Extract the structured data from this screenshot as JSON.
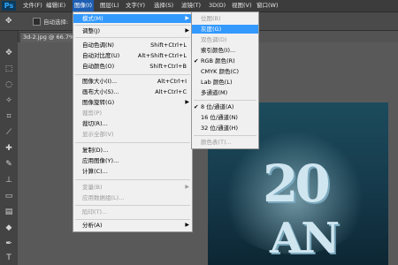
{
  "app": {
    "logo": "Ps"
  },
  "menubar": {
    "items": [
      "文件(F)",
      "编辑(E)",
      "图像(I)",
      "图层(L)",
      "文字(Y)",
      "选择(S)",
      "滤镜(T)",
      "3D(D)",
      "视图(V)",
      "窗口(W)"
    ],
    "active_index": 2
  },
  "options_bar": {
    "auto_select_label": "自动选择:"
  },
  "document": {
    "tab_title": "3d-2.jpg @ 66.7%"
  },
  "artwork": {
    "numerals": "20",
    "letters": "AN"
  },
  "image_menu": {
    "items": [
      {
        "label": "模式(M)",
        "submenu": true,
        "highlighted": true
      },
      {
        "label": "调整(J)",
        "submenu": true
      },
      {
        "label": "自动色调(N)",
        "shortcut": "Shift+Ctrl+L"
      },
      {
        "label": "自动对比度(U)",
        "shortcut": "Alt+Shift+Ctrl+L"
      },
      {
        "label": "自动颜色(O)",
        "shortcut": "Shift+Ctrl+B"
      },
      {
        "label": "图像大小(I)...",
        "shortcut": "Alt+Ctrl+I"
      },
      {
        "label": "画布大小(S)...",
        "shortcut": "Alt+Ctrl+C"
      },
      {
        "label": "图像旋转(G)",
        "submenu": true
      },
      {
        "label": "裁剪(P)",
        "disabled": true
      },
      {
        "label": "裁切(R)..."
      },
      {
        "label": "显示全部(V)",
        "disabled": true
      },
      {
        "label": "复制(D)..."
      },
      {
        "label": "应用图像(Y)..."
      },
      {
        "label": "计算(C)..."
      },
      {
        "label": "变量(B)",
        "submenu": true,
        "disabled": true
      },
      {
        "label": "应用数据组(L)...",
        "disabled": true
      },
      {
        "label": "陷印(T)...",
        "disabled": true
      },
      {
        "label": "分析(A)",
        "submenu": true
      }
    ]
  },
  "mode_menu": {
    "items": [
      {
        "label": "位图(B)",
        "disabled": true
      },
      {
        "label": "灰度(G)",
        "highlighted": true
      },
      {
        "label": "双色调(D)",
        "disabled": true
      },
      {
        "label": "索引颜色(I)..."
      },
      {
        "label": "RGB 颜色(R)",
        "checked": true
      },
      {
        "label": "CMYK 颜色(C)"
      },
      {
        "label": "Lab 颜色(L)"
      },
      {
        "label": "多通道(M)"
      },
      {
        "label": "8 位/通道(A)",
        "checked": true
      },
      {
        "label": "16 位/通道(N)"
      },
      {
        "label": "32 位/通道(H)"
      },
      {
        "label": "颜色表(T)...",
        "disabled": true
      }
    ]
  }
}
